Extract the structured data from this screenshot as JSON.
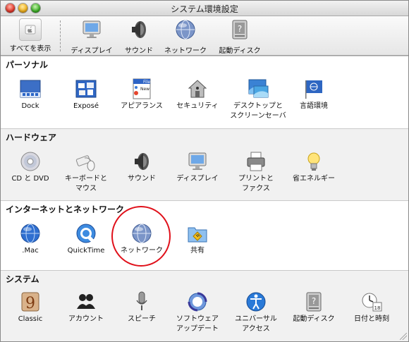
{
  "window": {
    "title": "システム環境設定"
  },
  "toolbar": {
    "show_all": "すべてを表示",
    "items": [
      "ディスプレイ",
      "サウンド",
      "ネットワーク",
      "起動ディスク"
    ]
  },
  "sections": [
    {
      "title": "パーソナル",
      "items": [
        "Dock",
        "Exposé",
        "アピアランス",
        "セキュリティ",
        "デスクトップと\nスクリーンセーバ",
        "言語環境"
      ]
    },
    {
      "title": "ハードウェア",
      "items": [
        "CD と DVD",
        "キーボードと\nマウス",
        "サウンド",
        "ディスプレイ",
        "プリントと\nファクス",
        "省エネルギー"
      ]
    },
    {
      "title": "インターネットとネットワーク",
      "items": [
        ".Mac",
        "QuickTime",
        "ネットワーク",
        "共有"
      ]
    },
    {
      "title": "システム",
      "items": [
        "Classic",
        "アカウント",
        "スピーチ",
        "ソフトウェア\nアップデート",
        "ユニバーサル\nアクセス",
        "起動ディスク",
        "日付と時刻"
      ]
    }
  ],
  "appearance_icon_text": {
    "file": "File",
    "new": "New"
  },
  "calendar_day": "18",
  "highlight": {
    "target": "ネットワーク",
    "color": "#e0101a"
  }
}
